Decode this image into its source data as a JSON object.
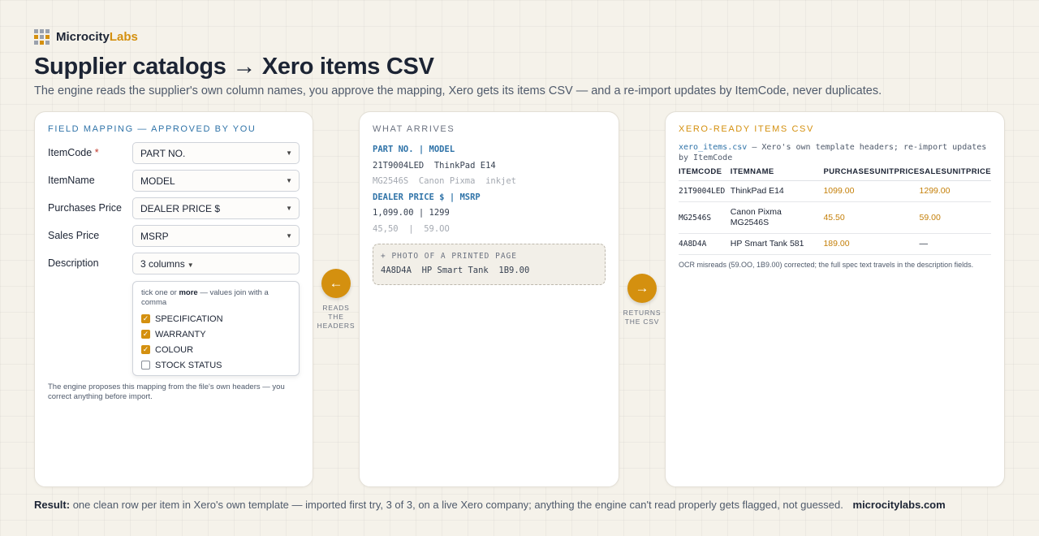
{
  "brand": {
    "name": "Microcity",
    "accent": "Labs"
  },
  "title": "Supplier catalogs → Xero items CSV",
  "subtitle": "The engine reads the supplier's own column names, you approve the mapping, Xero gets its items CSV — and a re-import updates by ItemCode, never duplicates.",
  "mapping": {
    "title": "FIELD MAPPING — APPROVED BY YOU",
    "rows": [
      {
        "label": "ItemCode",
        "required": "*",
        "value": "PART NO."
      },
      {
        "label": "ItemName",
        "value": "MODEL"
      },
      {
        "label": "Purchases Price",
        "value": "DEALER PRICE $"
      },
      {
        "label": "Sales Price",
        "value": "MSRP"
      },
      {
        "label": "Description",
        "value": "3 columns"
      }
    ],
    "dropdown": {
      "hint_pre": "tick one or",
      "hint_bold": "more",
      "hint_post": "— values join with a comma",
      "options": [
        {
          "label": "SPECIFICATION",
          "checked": true
        },
        {
          "label": "WARRANTY",
          "checked": true
        },
        {
          "label": "COLOUR",
          "checked": true
        },
        {
          "label": "STOCK STATUS",
          "checked": false
        }
      ]
    },
    "note": "The engine proposes this mapping from the file's own headers — you correct anything before import."
  },
  "arrives": {
    "title": "WHAT ARRIVES",
    "header1": "PART NO. | MODEL",
    "row1": "21T9004LED  ThinkPad E14",
    "row2": "MG2546S  Canon Pixma  inkjet",
    "header2": "DEALER PRICE $ | MSRP",
    "row3": "1,099.00 | 1299",
    "row4": "45,50  |  59.OO",
    "photo_caption": "+ PHOTO OF A PRINTED PAGE",
    "photo_value": "4A8D4A  HP Smart Tank  1B9.00"
  },
  "reads_button": {
    "icon": "←",
    "caption_lines": [
      "READS",
      "THE",
      "HEADERS"
    ]
  },
  "returns_button": {
    "icon": "→",
    "caption_lines": [
      "RETURNS",
      "THE CSV"
    ]
  },
  "csv": {
    "title": "XERO-READY ITEMS CSV",
    "filename": "xero_items.csv",
    "file_desc": " — Xero's own template headers; re-import updates by ItemCode",
    "columns": [
      "ITEMCODE",
      "ITEMNAME",
      "PURCHASESUNITPRICE",
      "SALESUNITPRICE"
    ],
    "rows": [
      {
        "code": "21T9004LED",
        "name": "ThinkPad E14",
        "purchase": "1099.00",
        "sales": "1299.00"
      },
      {
        "code": "MG2546S",
        "name": "Canon Pixma MG2546S",
        "purchase": "45.50",
        "sales": "59.00"
      },
      {
        "code": "4A8D4A",
        "name": "HP Smart Tank 581",
        "purchase": "189.00",
        "sales": "—"
      }
    ],
    "note": "OCR misreads (59.OO, 1B9.00) corrected; the full spec text travels in the description fields."
  },
  "result": {
    "label": "Result:",
    "text": "one clean row per item in Xero's own template — imported first try, 3 of 3, on a live Xero company; anything the engine can't read properly gets flagged, not guessed.",
    "site": "microcitylabs.com"
  },
  "colors": {
    "accent": "#d4900f",
    "link_blue": "#2f73a8",
    "required": "#c0392b"
  },
  "icons": [
    "logo-grid-icon",
    "caret-down-icon",
    "checkbox-icon",
    "arrow-left-icon",
    "arrow-right-icon"
  ]
}
